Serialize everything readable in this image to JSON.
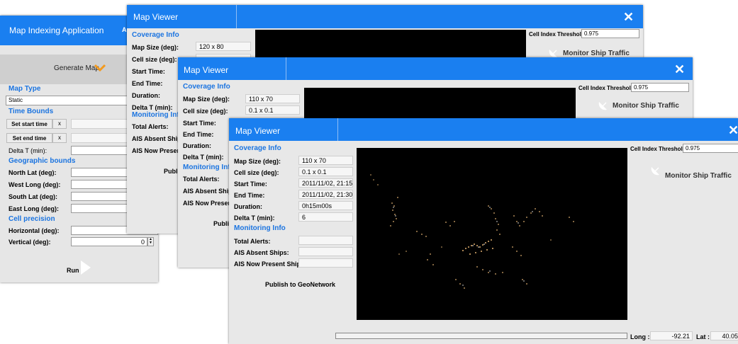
{
  "app": {
    "title": "Map Indexing Application",
    "title_tail": "A",
    "generate_label": "Generate Map",
    "map_type_header": "Map Type",
    "map_type_value": "Static",
    "time_bounds_header": "Time Bounds",
    "set_start": "Set start time",
    "set_end": "Set end time",
    "clear_x": "x",
    "delta_t_label": "Delta T (min):",
    "geo_header": "Geographic bounds",
    "north_lat": "North Lat (deg):",
    "west_long": "West Long (deg):",
    "south_lat": "South Lat (deg):",
    "east_long": "East Long (deg):",
    "cell_precision_header": "Cell precision",
    "horizontal": "Horizontal (deg):",
    "vertical": "Vertical (deg):",
    "vertical_value": "0",
    "run_label": "Run"
  },
  "viewer1": {
    "title": "Map Viewer",
    "close": "✕",
    "coverage_header": "Coverage Info",
    "map_size_label": "Map Size (deg):",
    "map_size": "120 x 80",
    "cell_size_label": "Cell size (deg):",
    "start_time_label": "Start Time:",
    "end_time_label": "End Time:",
    "duration_label": "Duration:",
    "delta_t_label": "Delta T (min):",
    "monitoring_header": "Monitoring Info",
    "total_alerts_label": "Total Alerts:",
    "ais_absent_label": "AIS Absent Ships:",
    "ais_now_label": "AIS Now Present S",
    "publish": "Publis",
    "threshold_label": "Cell Index Threshold:",
    "threshold_value": "0.975",
    "monitor_label": "Monitor Ship Traffic"
  },
  "viewer2": {
    "title": "Map Viewer",
    "close": "✕",
    "coverage_header": "Coverage Info",
    "map_size_label": "Map Size (deg):",
    "map_size": "110 x 70",
    "cell_size_label": "Cell size (deg):",
    "cell_size": "0.1 x 0.1",
    "start_time_label": "Start Time:",
    "end_time_label": "End Time:",
    "duration_label": "Duration:",
    "delta_t_label": "Delta T (min):",
    "monitoring_header": "Monitoring Info",
    "total_alerts_label": "Total Alerts:",
    "ais_absent_label": "AIS Absent Ships:",
    "ais_now_label": "AIS Now Present Sh",
    "publish": "Publis",
    "threshold_label": "Cell Index Threshold:",
    "threshold_value": "0.975",
    "monitor_label": "Monitor Ship Traffic"
  },
  "viewer3": {
    "title": "Map Viewer",
    "close": "✕",
    "coverage_header": "Coverage Info",
    "map_size_label": "Map Size (deg):",
    "map_size": "110 x 70",
    "cell_size_label": "Cell size (deg):",
    "cell_size": "0.1 x 0.1",
    "start_time_label": "Start Time:",
    "start_time": "2011/11/02, 21:15",
    "end_time_label": "End Time:",
    "end_time": "2011/11/02, 21:30",
    "duration_label": "Duration:",
    "duration": "0h15m00s",
    "delta_t_label": "Delta T (min):",
    "delta_t": "6",
    "monitoring_header": "Monitoring Info",
    "total_alerts_label": "Total Alerts:",
    "ais_absent_label": "AIS Absent Ships:",
    "ais_now_label": "AIS Now Present Ships:",
    "publish": "Publish to GeoNetwork",
    "threshold_label": "Cell Index Threshold:",
    "threshold_value": "0.975",
    "monitor_label": "Monitor Ship Traffic",
    "long_label": "Long :",
    "long_value": "-92.21",
    "lat_label": "Lat :",
    "lat_value": "40.05"
  },
  "colors": {
    "titlebar": "#1a7ff0",
    "section": "#1b74e0",
    "generate_chevron": "#f39a1e"
  }
}
